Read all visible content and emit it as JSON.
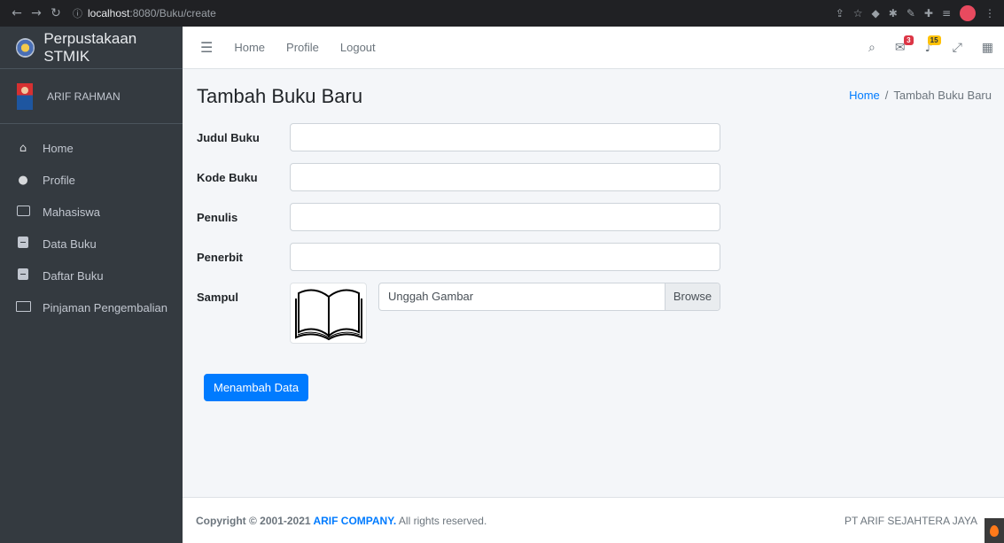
{
  "browser": {
    "url_host": "localhost",
    "url_path": ":8080/Buku/create"
  },
  "sidebar": {
    "brand": "Perpustakaan STMIK",
    "user_name": "ARIF RAHMAN",
    "items": [
      {
        "label": "Home",
        "icon": "home-icon"
      },
      {
        "label": "Profile",
        "icon": "user-icon"
      },
      {
        "label": "Mahasiswa",
        "icon": "id-card-icon"
      },
      {
        "label": "Data Buku",
        "icon": "book-icon"
      },
      {
        "label": "Daftar Buku",
        "icon": "book-icon"
      },
      {
        "label": "Pinjaman Pengembalian",
        "icon": "chalkboard-teacher-icon"
      }
    ]
  },
  "navbar": {
    "links": [
      "Home",
      "Profile",
      "Logout"
    ],
    "messages_badge": "3",
    "notifications_badge": "15"
  },
  "page": {
    "title": "Tambah Buku Baru",
    "breadcrumb_home": "Home",
    "breadcrumb_current": "Tambah Buku Baru"
  },
  "form": {
    "judul_label": "Judul Buku",
    "judul_value": "",
    "kode_label": "Kode Buku",
    "kode_value": "",
    "penulis_label": "Penulis",
    "penulis_value": "",
    "penerbit_label": "Penerbit",
    "penerbit_value": "",
    "sampul_label": "Sampul",
    "file_placeholder": "Unggah Gambar",
    "browse_label": "Browse",
    "submit_label": "Menambah Data"
  },
  "footer": {
    "copyright_prefix": "Copyright © 2001-2021 ",
    "company": "ARIF COMPANY.",
    "copyright_suffix": " All rights reserved.",
    "right_text": "PT ARIF SEJAHTERA JAYA"
  },
  "colors": {
    "sidebar_bg": "#343a40",
    "primary": "#007bff",
    "badge_red": "#dc3545",
    "badge_yellow": "#ffc107"
  }
}
